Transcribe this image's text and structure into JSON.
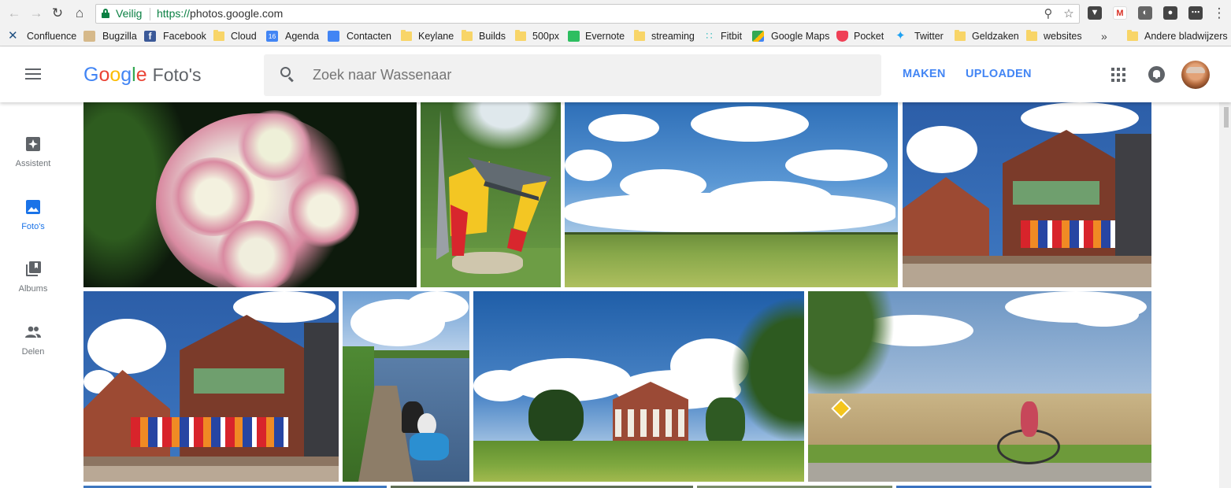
{
  "browser": {
    "address": {
      "security_label": "Veilig",
      "url_scheme": "https://",
      "url_host": "photos.google.com"
    },
    "bookmarks": [
      {
        "label": "Confluence",
        "icon": "confluence-icon",
        "color": "#205081"
      },
      {
        "label": "Bugzilla",
        "icon": "bugzilla-icon",
        "color": "#c9a26b"
      },
      {
        "label": "Facebook",
        "icon": "facebook-icon",
        "color": "#3b5998"
      },
      {
        "label": "Cloud",
        "icon": "folder-icon",
        "color": "#f8d568"
      },
      {
        "label": "Agenda",
        "icon": "calendar-icon",
        "color": "#4285f4"
      },
      {
        "label": "Contacten",
        "icon": "contacts-icon",
        "color": "#4285f4"
      },
      {
        "label": "Keylane",
        "icon": "folder-icon",
        "color": "#f8d568"
      },
      {
        "label": "Builds",
        "icon": "folder-icon",
        "color": "#f8d568"
      },
      {
        "label": "500px",
        "icon": "folder-icon",
        "color": "#f8d568"
      },
      {
        "label": "Evernote",
        "icon": "evernote-icon",
        "color": "#2dbe60"
      },
      {
        "label": "streaming",
        "icon": "folder-icon",
        "color": "#f8d568"
      },
      {
        "label": "Fitbit",
        "icon": "fitbit-icon",
        "color": "#4cc2c4"
      },
      {
        "label": "Google Maps",
        "icon": "maps-icon",
        "color": "#34a853"
      },
      {
        "label": "Pocket",
        "icon": "pocket-icon",
        "color": "#ef4056"
      },
      {
        "label": "Twitter",
        "icon": "twitter-icon",
        "color": "#1da1f2"
      },
      {
        "label": "Geldzaken",
        "icon": "folder-icon",
        "color": "#f8d568"
      },
      {
        "label": "websites",
        "icon": "folder-icon",
        "color": "#f8d568"
      }
    ],
    "calendar_day": "16",
    "more_bookmarks": "»",
    "other_bookmarks": "Andere bladwijzers"
  },
  "app": {
    "logo_word": [
      "G",
      "o",
      "o",
      "g",
      "l",
      "e"
    ],
    "product": "Foto's",
    "search_placeholder": "Zoek naar Wassenaar",
    "create_label": "MAKEN",
    "upload_label": "UPLOADEN"
  },
  "nav": [
    {
      "label": "Assistent",
      "icon": "assistant-icon",
      "active": false
    },
    {
      "label": "Foto's",
      "icon": "photos-icon",
      "active": true
    },
    {
      "label": "Albums",
      "icon": "albums-icon",
      "active": false
    },
    {
      "label": "Delen",
      "icon": "sharing-icon",
      "active": false
    }
  ],
  "colors": {
    "accent": "#4285f4",
    "active_nav": "#1a73e8",
    "secure_green": "#0b8043"
  },
  "photos": [
    {
      "subject": "pink-white-geranium-flowers"
    },
    {
      "subject": "colorful-bus-shelter"
    },
    {
      "subject": "dutch-meadow-with-clouds"
    },
    {
      "subject": "cafe-with-flags"
    },
    {
      "subject": "cafe-with-flags-wide"
    },
    {
      "subject": "canal-jetty-with-people"
    },
    {
      "subject": "farmhouse-with-trees"
    },
    {
      "subject": "cyclists-near-field"
    }
  ]
}
